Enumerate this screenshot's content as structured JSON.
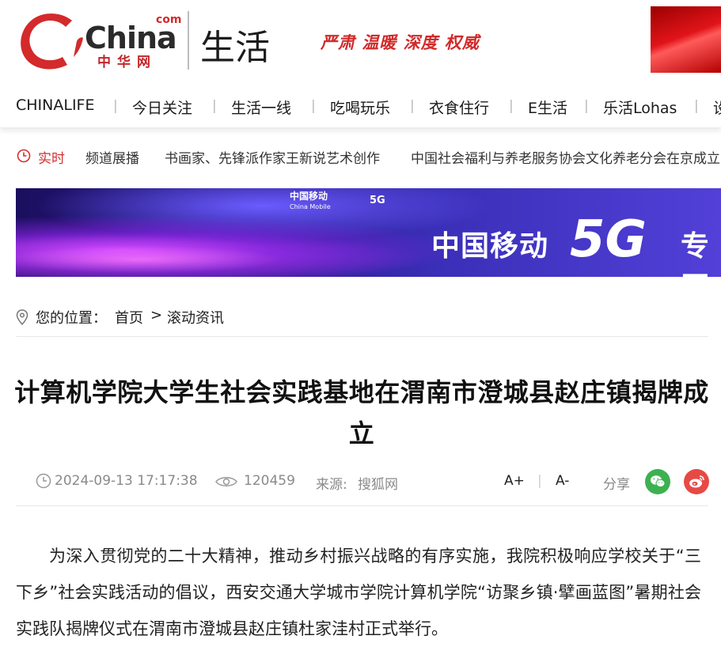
{
  "header": {
    "logo_text": "China",
    "logo_com": "com",
    "logo_cn": "中华网",
    "channel_name": "生活",
    "slogan": "严肃 温暖 深度 权威"
  },
  "nav": {
    "items": [
      "CHINALIFE",
      "今日关注",
      "生活一线",
      "吃喝玩乐",
      "衣食住行",
      "E生活",
      "乐活Lohas",
      "设"
    ]
  },
  "ticker": {
    "label": "实时",
    "channel": "频道展播",
    "news": [
      "书画家、先锋派作家王新说艺术创作",
      "中国社会福利与养老服务协会文化养老分会在京成立"
    ]
  },
  "banner": {
    "brand_cn": "中国移动",
    "brand_en": "China Mobile",
    "badge": "5G",
    "title": "中国移动",
    "highlight": "5G",
    "zone": "专区"
  },
  "breadcrumb": {
    "prefix": "您的位置：",
    "home": "首页",
    "separator": ">",
    "current": "滚动资讯"
  },
  "article": {
    "title": "计算机学院大学生社会实践基地在渭南市澄城县赵庄镇揭牌成立",
    "date": "2024-09-13 17:17:38",
    "views": "120459",
    "source_label": "来源:",
    "source": "搜狐网",
    "font_up": "A+",
    "font_sep": "|",
    "font_down": "A-",
    "share_label": "分享",
    "paragraph": "为深入贯彻党的二十大精神，推动乡村振兴战略的有序实施，我院积极响应学校关于“三下乡”社会实践活动的倡议，西安交通大学城市学院计算机学院“访聚乡镇·擘画蓝图”暑期社会实践队揭牌仪式在渭南市澄城县赵庄镇杜家洼村正式举行。"
  },
  "colors": {
    "brand_red": "#d3302f",
    "wechat_green": "#3db150",
    "weibo_red": "#e64a45"
  }
}
